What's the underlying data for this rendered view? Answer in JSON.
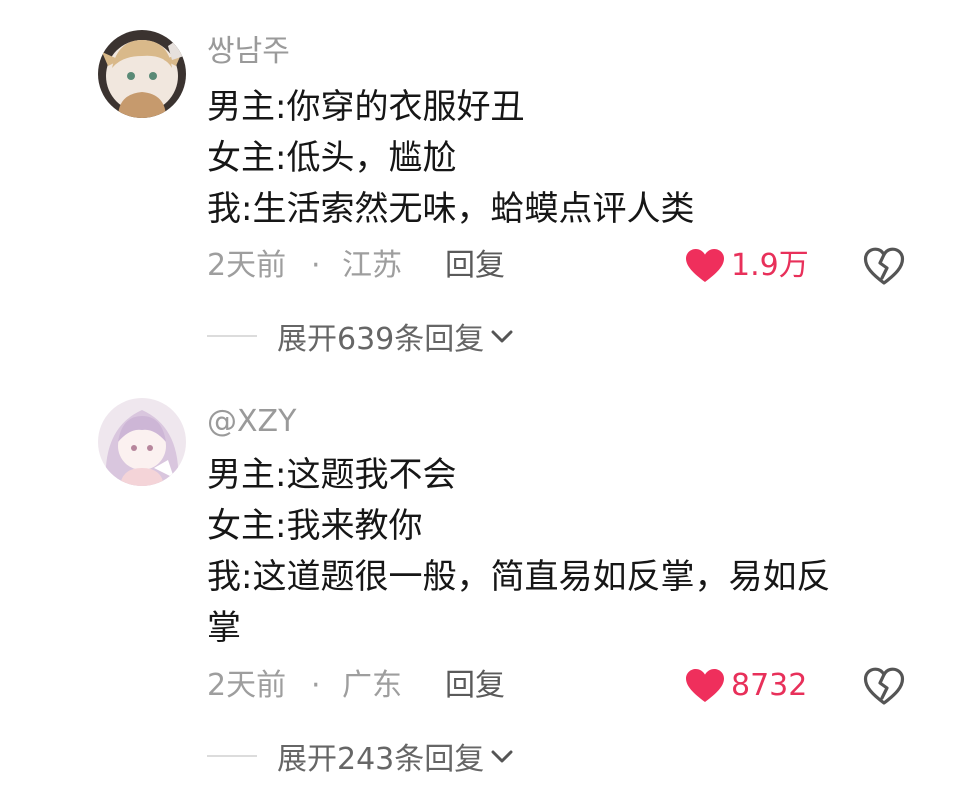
{
  "comments": [
    {
      "username": "쌍남주",
      "lines": [
        "男主:你穿的衣服好丑",
        "女主:低头，尴尬",
        "我:生活索然无味，蛤蟆点评人类"
      ],
      "time": "2天前",
      "separator": "·",
      "location": "江苏",
      "reply_label": "回复",
      "likes": "1.9万",
      "expand_label": "展开639条回复",
      "avatar_icon": "anime-avatar-blond-character",
      "like_color": "#e8305a"
    },
    {
      "username": "@XZY",
      "lines": [
        "男主:这题我不会",
        "女主:我来教你",
        "我:这道题很一般，简直易如反掌，易如反",
        "掌"
      ],
      "time": "2天前",
      "separator": "·",
      "location": "广东",
      "reply_label": "回复",
      "likes": "8732",
      "expand_label": "展开243条回复",
      "avatar_icon": "anime-avatar-pink-hair-character",
      "like_color": "#e8305a"
    }
  ]
}
